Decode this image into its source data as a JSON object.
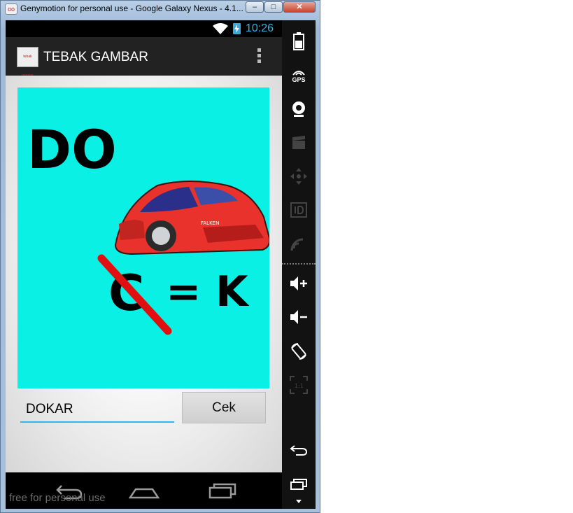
{
  "window": {
    "title": "Genymotion for personal use - Google Galaxy Nexus - 4.1...",
    "icon_name": "genymotion-logo-icon",
    "controls": [
      "minimize-icon",
      "maximize-icon",
      "close-icon"
    ]
  },
  "statusbar": {
    "time": "10:26",
    "icons": [
      "wifi-icon",
      "battery-charging-icon"
    ],
    "accent_color": "#33b5e5"
  },
  "actionbar": {
    "logo_text": "tebak gambar",
    "title": "TEBAK GAMBAR",
    "menu_icon": "overflow-menu-icon"
  },
  "puzzle": {
    "background_color": "#0af0e4",
    "text_top": "DO",
    "crossed_letter": "C",
    "equation": "= K",
    "car_badge": "FALKEN"
  },
  "answer": {
    "value": "DOKAR",
    "underline_color": "#33b5e5"
  },
  "button": {
    "label": "Cek"
  },
  "navbar": {
    "buttons": [
      "back-icon",
      "home-icon",
      "recent-apps-icon"
    ]
  },
  "watermark": "free for personal use",
  "sidebar": {
    "gps_label": "GPS",
    "icons": [
      "battery-icon",
      "gps-icon",
      "camera-icon",
      "video-capture-icon",
      "dpad-icon",
      "device-id-icon",
      "cast-icon",
      "volume-up-icon",
      "volume-down-icon",
      "rotate-icon",
      "scale-icon",
      "back-icon",
      "recent-apps-icon",
      "menu-down-icon"
    ]
  }
}
